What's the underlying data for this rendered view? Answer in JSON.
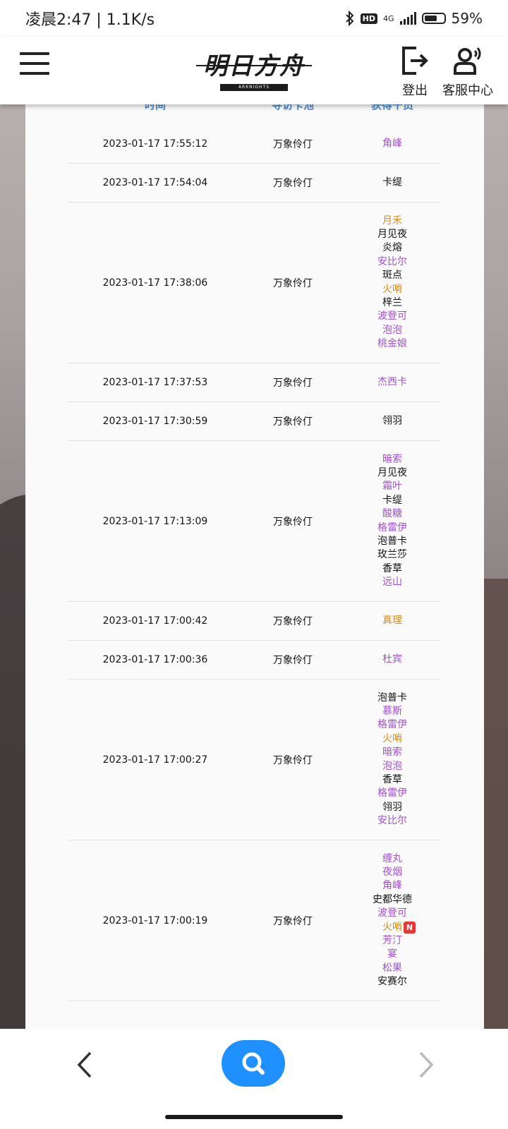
{
  "status_bar": {
    "left_text": "凌晨2:47 | 1.1K/s",
    "hd": "HD",
    "network": "4G",
    "battery": "59%"
  },
  "header": {
    "logo_text": "明日方舟",
    "logo_sub": "ARKNIGHTS",
    "logout_label": "登出",
    "service_label": "客服中心"
  },
  "table": {
    "headers": [
      "时间",
      "寻访卡池",
      "获得干员"
    ],
    "rows": [
      {
        "time": "2023-01-17 17:55:12",
        "pool": "万象伶仃",
        "ops": [
          {
            "name": "角峰",
            "color": "purple"
          }
        ]
      },
      {
        "time": "2023-01-17 17:54:04",
        "pool": "万象伶仃",
        "ops": [
          {
            "name": "卡缇",
            "color": "black"
          }
        ]
      },
      {
        "time": "2023-01-17 17:38:06",
        "pool": "万象伶仃",
        "ops": [
          {
            "name": "月禾",
            "color": "gold"
          },
          {
            "name": "月见夜",
            "color": "black"
          },
          {
            "name": "炎熔",
            "color": "black"
          },
          {
            "name": "安比尔",
            "color": "purple"
          },
          {
            "name": "斑点",
            "color": "black"
          },
          {
            "name": "火哨",
            "color": "gold"
          },
          {
            "name": "梓兰",
            "color": "black"
          },
          {
            "name": "波登可",
            "color": "purple"
          },
          {
            "name": "泡泡",
            "color": "purple"
          },
          {
            "name": "桃金娘",
            "color": "purple"
          }
        ]
      },
      {
        "time": "2023-01-17 17:37:53",
        "pool": "万象伶仃",
        "ops": [
          {
            "name": "杰西卡",
            "color": "purple"
          }
        ]
      },
      {
        "time": "2023-01-17 17:30:59",
        "pool": "万象伶仃",
        "ops": [
          {
            "name": "翎羽",
            "color": "black"
          }
        ]
      },
      {
        "time": "2023-01-17 17:13:09",
        "pool": "万象伶仃",
        "ops": [
          {
            "name": "暗索",
            "color": "purple"
          },
          {
            "name": "月见夜",
            "color": "black"
          },
          {
            "name": "霜叶",
            "color": "purple"
          },
          {
            "name": "卡缇",
            "color": "black"
          },
          {
            "name": "酸糖",
            "color": "purple"
          },
          {
            "name": "格雷伊",
            "color": "purple"
          },
          {
            "name": "泡普卡",
            "color": "black"
          },
          {
            "name": "玫兰莎",
            "color": "black"
          },
          {
            "name": "香草",
            "color": "black"
          },
          {
            "name": "远山",
            "color": "purple"
          }
        ]
      },
      {
        "time": "2023-01-17 17:00:42",
        "pool": "万象伶仃",
        "ops": [
          {
            "name": "真理",
            "color": "gold"
          }
        ]
      },
      {
        "time": "2023-01-17 17:00:36",
        "pool": "万象伶仃",
        "ops": [
          {
            "name": "杜宾",
            "color": "purple"
          }
        ]
      },
      {
        "time": "2023-01-17 17:00:27",
        "pool": "万象伶仃",
        "ops": [
          {
            "name": "泡普卡",
            "color": "black"
          },
          {
            "name": "慕斯",
            "color": "purple"
          },
          {
            "name": "格雷伊",
            "color": "purple"
          },
          {
            "name": "火哨",
            "color": "gold"
          },
          {
            "name": "暗索",
            "color": "purple"
          },
          {
            "name": "泡泡",
            "color": "purple"
          },
          {
            "name": "香草",
            "color": "black"
          },
          {
            "name": "格雷伊",
            "color": "purple"
          },
          {
            "name": "翎羽",
            "color": "black"
          },
          {
            "name": "安比尔",
            "color": "purple"
          }
        ]
      },
      {
        "time": "2023-01-17 17:00:19",
        "pool": "万象伶仃",
        "ops": [
          {
            "name": "缠丸",
            "color": "purple"
          },
          {
            "name": "夜烟",
            "color": "purple"
          },
          {
            "name": "角峰",
            "color": "purple"
          },
          {
            "name": "史都华德",
            "color": "black"
          },
          {
            "name": "波登可",
            "color": "purple"
          },
          {
            "name": "火哨",
            "color": "gold",
            "badge": "N"
          },
          {
            "name": "芳汀",
            "color": "purple"
          },
          {
            "name": "宴",
            "color": "purple"
          },
          {
            "name": "松果",
            "color": "purple"
          },
          {
            "name": "安赛尔",
            "color": "black"
          }
        ]
      }
    ]
  },
  "colors": {
    "header_text": "#4b86c5",
    "gold": "#d18b1f",
    "purple": "#a24fd0",
    "search_button": "#1e90ff",
    "new_badge": "#e53935"
  },
  "icons": {
    "menu": "hamburger-icon",
    "logout": "logout-icon",
    "service": "customer-service-icon",
    "prev": "chevron-left-icon",
    "search": "search-icon",
    "next": "chevron-right-icon"
  }
}
